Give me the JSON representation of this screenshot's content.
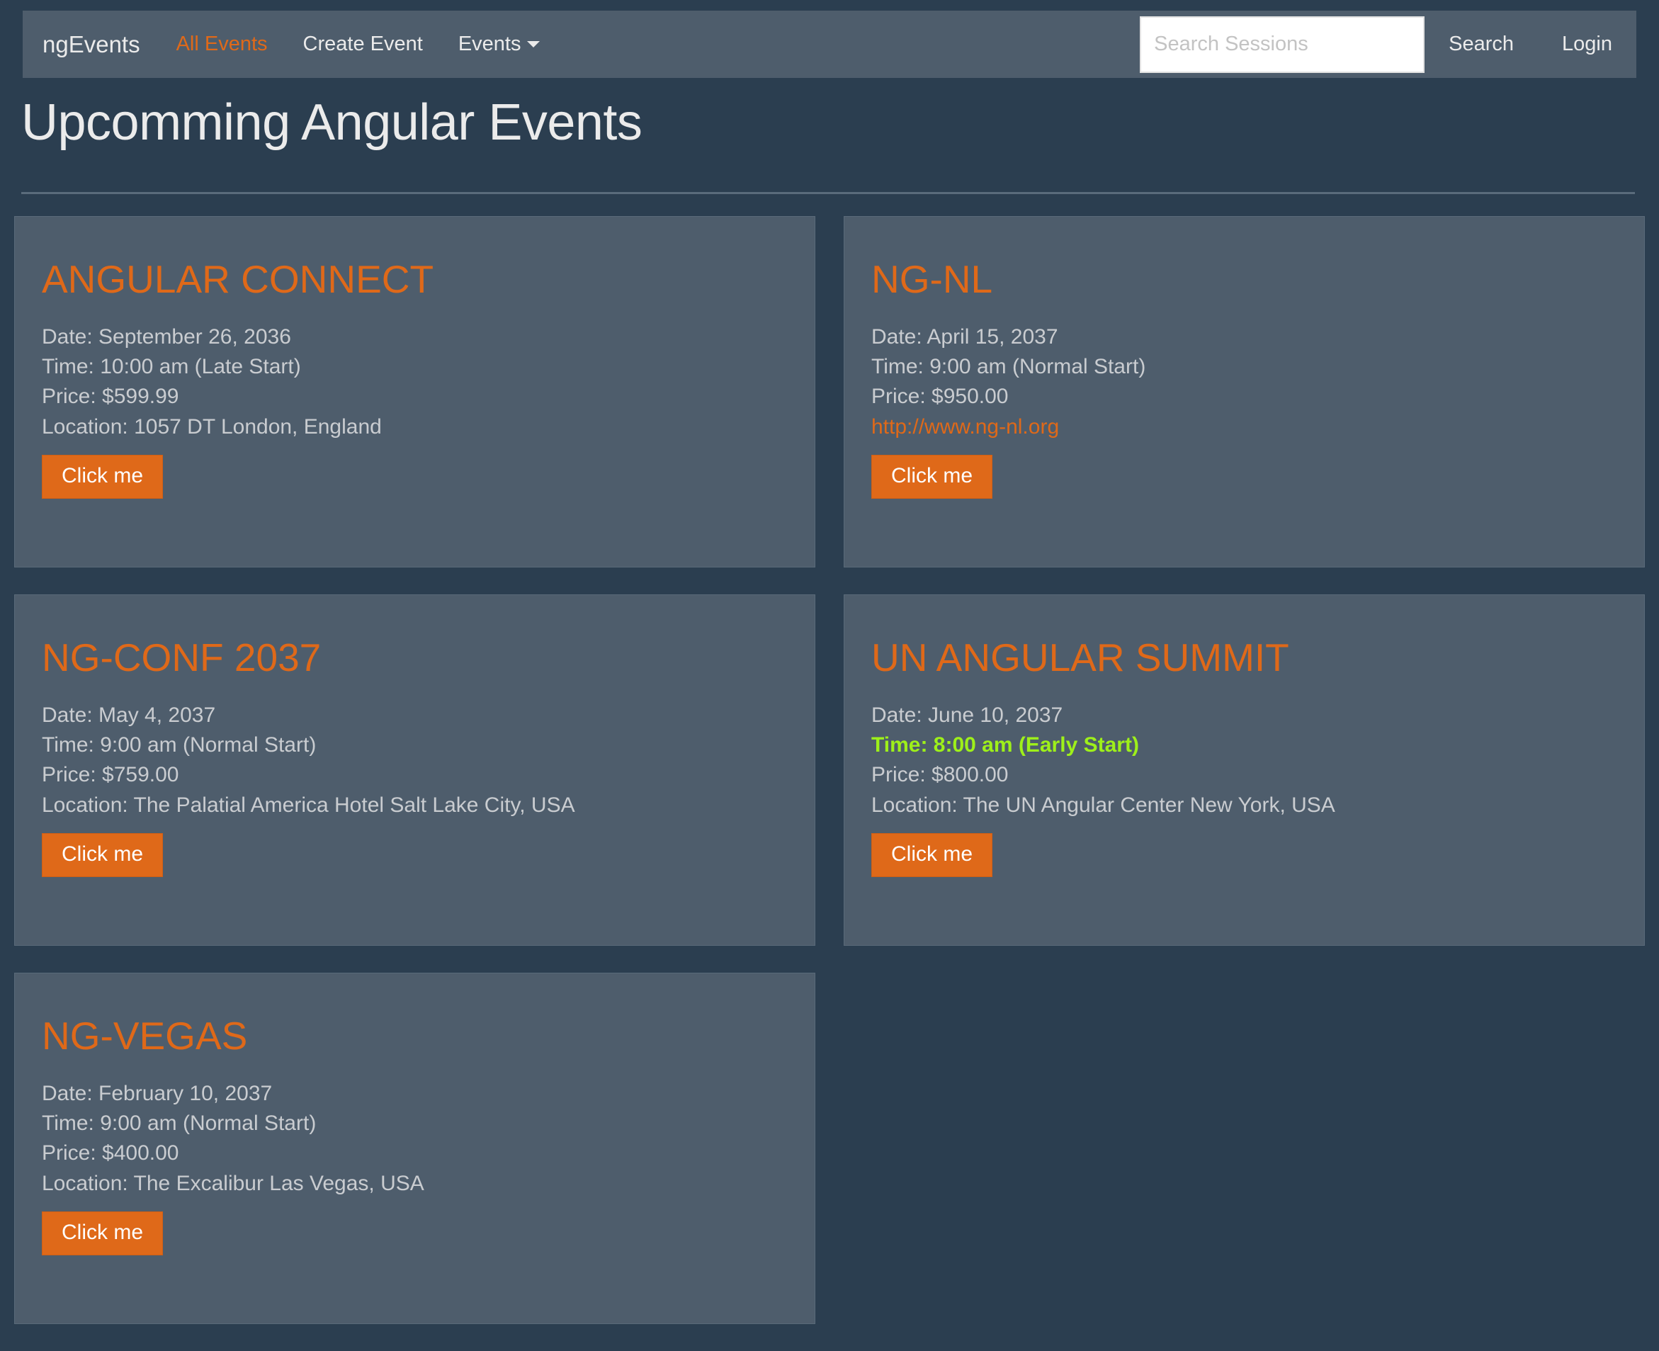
{
  "navbar": {
    "brand": "ngEvents",
    "links": [
      {
        "label": "All Events",
        "active": true
      },
      {
        "label": "Create Event",
        "active": false
      },
      {
        "label": "Events",
        "active": false,
        "caret": true
      }
    ],
    "search": {
      "placeholder": "Search Sessions",
      "value": "",
      "button_label": "Search"
    },
    "login_label": "Login"
  },
  "page": {
    "title": "Upcomming Angular Events"
  },
  "labels": {
    "click_me": "Click me"
  },
  "colors": {
    "page_bg": "#2b3e50",
    "panel_bg": "#4e5d6c",
    "accent_orange": "#df6919",
    "early_green": "#9ef01a",
    "body_text": "#c9ccd0"
  },
  "events": [
    {
      "name": "ANGULAR CONNECT",
      "date": "Date: September 26, 2036",
      "time": "Time: 10:00 am (Late Start)",
      "time_early": false,
      "price": "Price: $599.99",
      "location": "Location: 1057 DT   London, England",
      "url": null,
      "button": "Click me"
    },
    {
      "name": "NG-NL",
      "date": "Date: April 15, 2037",
      "time": "Time: 9:00 am (Normal Start)",
      "time_early": false,
      "price": "Price: $950.00",
      "location": null,
      "url": "http://www.ng-nl.org",
      "button": "Click me"
    },
    {
      "name": "NG-CONF 2037",
      "date": "Date: May 4, 2037",
      "time": "Time: 9:00 am (Normal Start)",
      "time_early": false,
      "price": "Price: $759.00",
      "location": "Location: The Palatial America Hotel   Salt Lake City, USA",
      "url": null,
      "button": "Click me"
    },
    {
      "name": "UN ANGULAR SUMMIT",
      "date": "Date: June 10, 2037",
      "time": "Time: 8:00 am (Early Start)",
      "time_early": true,
      "price": "Price: $800.00",
      "location": "Location: The UN Angular Center   New York, USA",
      "url": null,
      "button": "Click me"
    },
    {
      "name": "NG-VEGAS",
      "date": "Date: February 10, 2037",
      "time": "Time: 9:00 am (Normal Start)",
      "time_early": false,
      "price": "Price: $400.00",
      "location": "Location: The Excalibur   Las Vegas, USA",
      "url": null,
      "button": "Click me"
    }
  ]
}
